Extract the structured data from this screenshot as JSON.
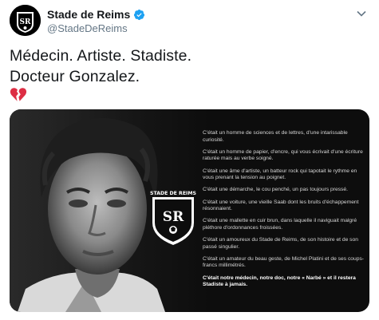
{
  "account": {
    "name": "Stade de Reims",
    "handle": "@StadeDeReims",
    "verified": true,
    "avatar_icon": "stade-de-reims-crest",
    "verified_icon": "verified-badge-icon",
    "menu_icon": "chevron-down-icon"
  },
  "tweet": {
    "line1": "Médecin. Artiste. Stadiste.",
    "line2": "Docteur Gonzalez.",
    "emoji_icon": "broken-heart-icon"
  },
  "media": {
    "crest_text": "STADE DE REIMS",
    "crest_monogram": "SR",
    "paragraphs": [
      "C'était un homme de sciences et de lettres, d'une intarissable curiosité.",
      "C'était un homme de papier, d'encre, qui vous écrivait d'une écriture raturée mais au verbe soigné.",
      "C'était une âme d'artiste, un batteur rock qui tapotait le rythme en vous prenant la tension au poignet.",
      "C'était une démarche, le cou penché, un pas toujours pressé.",
      "C'était une voiture, une vieille Saab dont les bruits d'échappement résonnaient.",
      "C'était une mallette en cuir brun, dans laquelle il naviguait malgré pléthore d'ordonnances froissées.",
      "C'était un amoureux du Stade de Reims, de son histoire et de son passé singulier.",
      "C'était un amateur du beau geste, de Michel Platini et de ses coups-francs millimétrés.",
      "C'était notre médecin, notre doc, notre « Narbé » et il restera Stadiste à jamais."
    ]
  },
  "colors": {
    "text_primary": "#14171a",
    "text_secondary": "#657786",
    "verified_blue": "#1da1f2",
    "heart_red": "#dd2e44",
    "media_bg": "#0d0d0d"
  }
}
